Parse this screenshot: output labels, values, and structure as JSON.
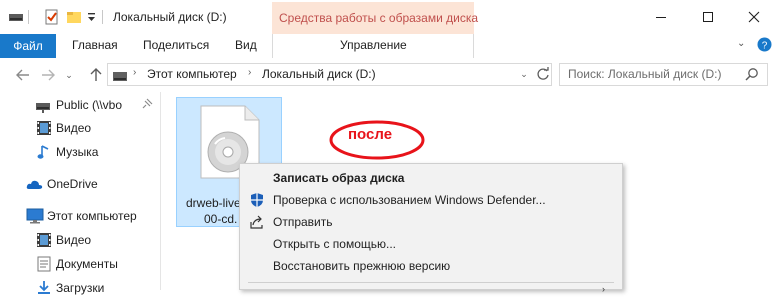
{
  "window": {
    "title": "Локальный диск (D:)",
    "contextual_group": "Средства работы с образами диска",
    "controls": [
      "minimize",
      "maximize",
      "close"
    ]
  },
  "ribbon": {
    "file_tab": "Файл",
    "tabs": [
      "Главная",
      "Поделиться",
      "Вид"
    ],
    "contextual_tab": "Управление",
    "accent_color": "#1979ca",
    "contextual_color": "#c0504d"
  },
  "address": {
    "path": [
      "Этот компьютер",
      "Локальный диск (D:)"
    ],
    "search_placeholder": "Поиск: Локальный диск (D:)"
  },
  "nav_pane": {
    "items": [
      {
        "label": "Public (\\\\vbo",
        "icon": "drive-icon",
        "pinned": true
      },
      {
        "label": "Видео",
        "icon": "video-icon"
      },
      {
        "label": "Музыка",
        "icon": "music-icon"
      },
      {
        "label": "OneDrive",
        "icon": "onedrive-icon"
      },
      {
        "label": "Этот компьютер",
        "icon": "computer-icon"
      },
      {
        "label": "Видео",
        "icon": "video-icon"
      },
      {
        "label": "Документы",
        "icon": "documents-icon"
      },
      {
        "label": "Загрузки",
        "icon": "downloads-icon"
      }
    ]
  },
  "content": {
    "file": {
      "name_line1": "drweb-live",
      "name_line2": "00-cd.",
      "icon": "disc-image-icon"
    },
    "annotation": "после"
  },
  "context_menu": {
    "items": [
      {
        "label": "Записать образ диска",
        "bold": true,
        "icon": ""
      },
      {
        "label": "Проверка с использованием Windows Defender...",
        "icon": "defender-icon"
      },
      {
        "label": "Отправить",
        "icon": "share-icon"
      },
      {
        "label": "Открыть с помощью...",
        "icon": ""
      },
      {
        "label": "Восстановить прежнюю версию",
        "icon": ""
      }
    ]
  }
}
